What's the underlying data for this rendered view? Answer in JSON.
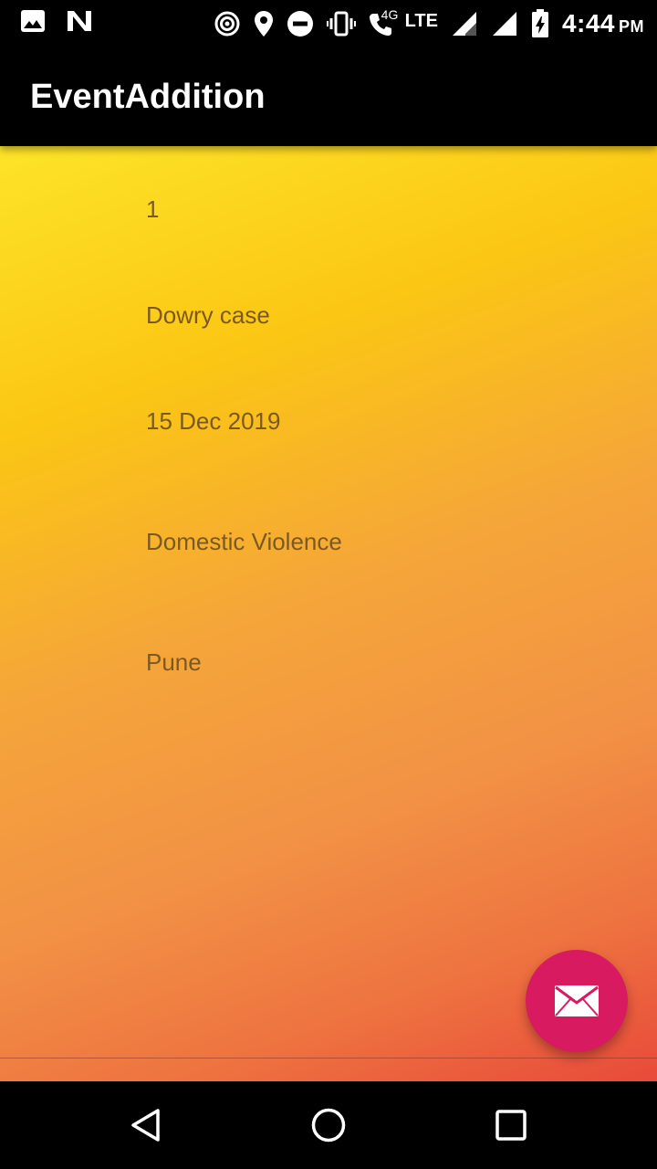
{
  "status_bar": {
    "left_icons": [
      "image-icon",
      "n-app-icon"
    ],
    "right_icons": [
      "hotspot-icon",
      "location-icon",
      "dnd-icon",
      "vibrate-icon",
      "wifi-call-icon",
      "signal-icon",
      "signal-icon-2",
      "battery-charging-icon"
    ],
    "network_4g": "4G",
    "network_lte": "LTE",
    "time": "4:44",
    "ampm": "PM"
  },
  "app_bar": {
    "title": "EventAddition"
  },
  "event": {
    "id": "1",
    "title": "Dowry case",
    "date": "15 Dec 2019",
    "category": "Domestic Violence",
    "location": "Pune"
  },
  "fab": {
    "icon": "mail-icon",
    "color": "#d81b60"
  },
  "nav_bar": {
    "icons": [
      "back-icon",
      "home-icon",
      "recents-icon"
    ]
  },
  "colors": {
    "gradient_start": "#fde428",
    "gradient_end": "#e84a3a",
    "text": "#7a5a22"
  }
}
